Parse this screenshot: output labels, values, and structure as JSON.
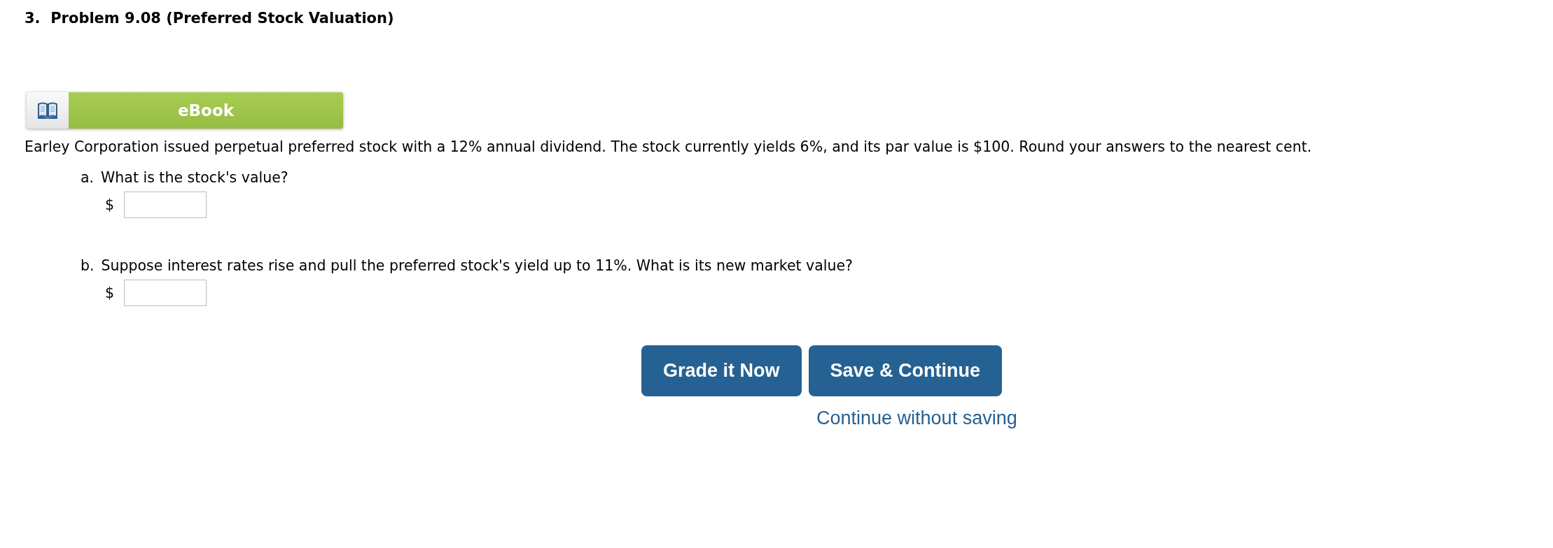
{
  "title": "3.  Problem 9.08 (Preferred Stock Valuation)",
  "ebook": {
    "label": "eBook"
  },
  "intro": "Earley Corporation issued perpetual preferred stock with a 12% annual dividend. The stock currently yields 6%, and its par value is $100. Round your answers to the nearest cent.",
  "questions": [
    {
      "letter": "a.",
      "text": "What is the stock's value?",
      "unit": "$"
    },
    {
      "letter": "b.",
      "text": "Suppose interest rates rise and pull the preferred stock's yield up to 11%. What is its new market value?",
      "unit": "$"
    }
  ],
  "buttons": [
    "Grade it Now",
    "Save & Continue"
  ],
  "link": "Continue without saving"
}
